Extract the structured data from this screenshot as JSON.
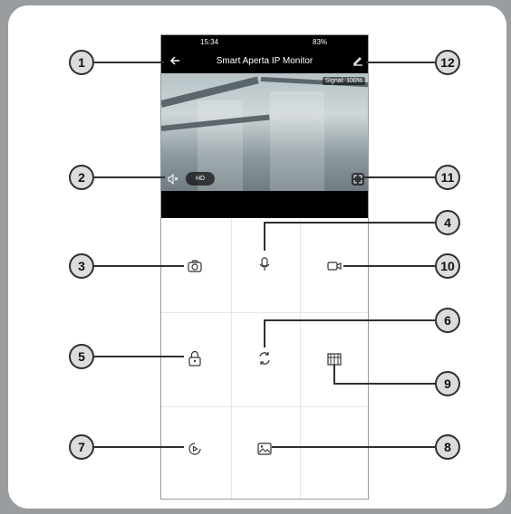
{
  "statusbar": {
    "time": "15:34",
    "right": "83%"
  },
  "appbar": {
    "title": "Smart Aperta IP Monitor"
  },
  "video": {
    "signal": "Signal: 100%",
    "hd_label": "HD"
  },
  "icons": {
    "back": "back-arrow-icon",
    "edit": "edit-pencil-icon",
    "mute": "speaker-mute-icon",
    "fullscreen": "fullscreen-icon",
    "camera": "camera-icon",
    "mic": "microphone-icon",
    "video": "video-record-icon",
    "lock": "lock-icon",
    "cycle": "switch-cycle-icon",
    "gate": "gate-icon",
    "playback": "playback-icon",
    "gallery": "gallery-icon"
  },
  "callouts": [
    "1",
    "2",
    "3",
    "4",
    "5",
    "6",
    "7",
    "8",
    "9",
    "10",
    "11",
    "12"
  ],
  "colors": {
    "phone_bar": "#000000",
    "callout_fill": "#dcdcdc",
    "callout_border": "#2f2f2f",
    "page_bg": "#9a9d9f"
  }
}
